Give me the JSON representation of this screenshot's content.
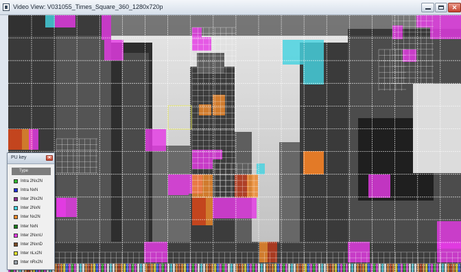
{
  "window": {
    "title": "Video View: V031055_Times_Square_360_1280x720p"
  },
  "pu_key": {
    "title": "PU key",
    "column_header": "Type",
    "items": [
      {
        "label": "Intra 2Nx2N",
        "color": "#2fb52f"
      },
      {
        "label": "Intra NxN",
        "color": "#1f2fd6"
      },
      {
        "label": "Inter 2Nx2N",
        "color": "#8a2b8a"
      },
      {
        "label": "Inter 2NxN",
        "color": "#45d3e0"
      },
      {
        "label": "Inter Nx2N",
        "color": "#f0892a"
      },
      {
        "label": "Inter NxN",
        "color": "#1b7a1b"
      },
      {
        "label": "Inter 2NxnU",
        "color": "#e53be5"
      },
      {
        "label": "Inter 2NxnD",
        "color": "#7a4a26"
      },
      {
        "label": "Inter nLx2N",
        "color": "#e3e32e"
      },
      {
        "label": "Inter nRx2N",
        "color": "#9aa3aa"
      }
    ]
  }
}
